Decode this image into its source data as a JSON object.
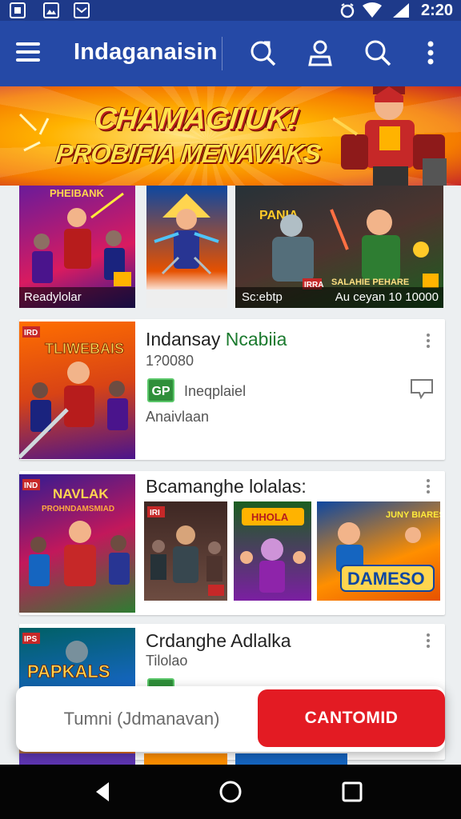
{
  "status_bar": {
    "time": "2:20"
  },
  "app_bar": {
    "title": "Indaganaisin"
  },
  "banner": {
    "line1": "CHAMAGIIUK!",
    "line2": "PROBIFIA MENAVAKS"
  },
  "top_row": [
    {
      "caption": "Readylolar",
      "art_text": "PHEIBANK"
    },
    {
      "caption": ""
    },
    {
      "caption": "Sc:ebtp",
      "caption_right": "Au ceyan 10 10000",
      "badge": "IRRA",
      "art_text": "PANIA",
      "art_label": "SALAHIE PEHARE"
    }
  ],
  "cards": [
    {
      "title_main": "Indansay ",
      "title_accent": "Ncabiia",
      "subtitle": "1?0080",
      "badge": "GP",
      "meta": "Ineqplaiel",
      "footer": "Anaivlaan",
      "thumb_text": "TLIWEBAIS",
      "thumb_badge": "IRD"
    },
    {
      "title": "Bcamanghe lolalas:",
      "thumb_text": "NAVLAK",
      "thumb_sub": "PROHNDAMSMIAD",
      "thumb_badge": "IND",
      "screens": [
        {
          "badge": "IRI"
        },
        {
          "art_text": "HHOLA"
        },
        {
          "art_text": "DAMESO",
          "art_top": "JUNY BIARES"
        }
      ]
    },
    {
      "title": "Crdanghe Adlalka",
      "subtitle": "Tilolao",
      "thumb_text": "PAPKALS",
      "thumb_badge": "IPS",
      "badge": "GP"
    }
  ],
  "action_sheet": {
    "secondary": "Tumni  (Jdmanavan)",
    "primary": "CANTOMID"
  },
  "colors": {
    "app_bar": "#2549a6",
    "status_bar": "#1e3a8a",
    "primary_button": "#e31b23",
    "accent_green": "#1b7a2e"
  }
}
